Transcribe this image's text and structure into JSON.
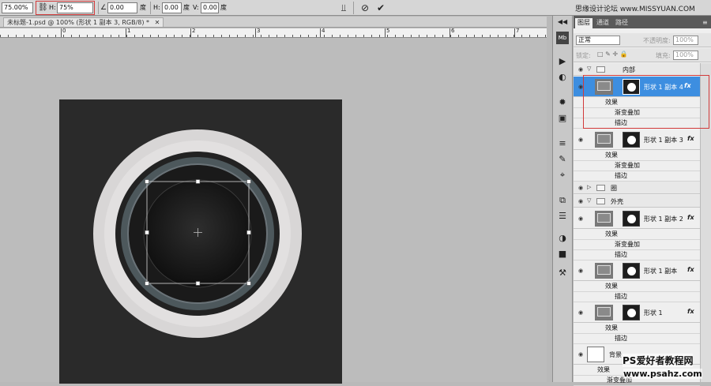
{
  "options_bar": {
    "zoom_value": "75.00%",
    "h_label": "H:",
    "h_value": "75%",
    "angle_value": "0.00",
    "angle_unit": "度",
    "h_skew_label": "H:",
    "h_skew_value": "0.00",
    "h_skew_unit": "度",
    "v_skew_label": "V:",
    "v_skew_value": "0.00",
    "v_skew_unit": "度",
    "watermark": "思缘设计论坛 www.MISSYUAN.COM"
  },
  "document": {
    "tab_label": "未标题-1.psd @ 100% (形状 1 副本 3, RGB/8) *",
    "ruler_numbers": [
      "0",
      "1",
      "2",
      "3",
      "4",
      "5",
      "6",
      "7"
    ]
  },
  "layers_panel": {
    "tabs": [
      "图层",
      "通道",
      "路径"
    ],
    "blend_mode": "正常",
    "opacity_label": "不透明度:",
    "opacity_value": "100%",
    "lock_label": "锁定:",
    "fill_label": "填充:",
    "fill_value": "100%",
    "effects_label": "效果",
    "gradient_overlay": "渐变叠加",
    "stroke": "描边",
    "groups": {
      "inner": "内部",
      "ring": "圈",
      "shell": "外壳"
    },
    "layers": {
      "copy4": "形状 1 副本 4",
      "copy3": "形状 1 副本 3",
      "copy2": "形状 1 副本 2",
      "copy1": "形状 1 副本",
      "base": "形状 1",
      "background": "背景"
    },
    "fx_label": "fx"
  },
  "site_mark": {
    "line1": "PS爱好者教程网",
    "line2": "www.psahz.com"
  },
  "colors": {
    "selection": "#3d8ee0",
    "highlight_box": "#d23a3a",
    "artboard": "#2a2a2a"
  }
}
